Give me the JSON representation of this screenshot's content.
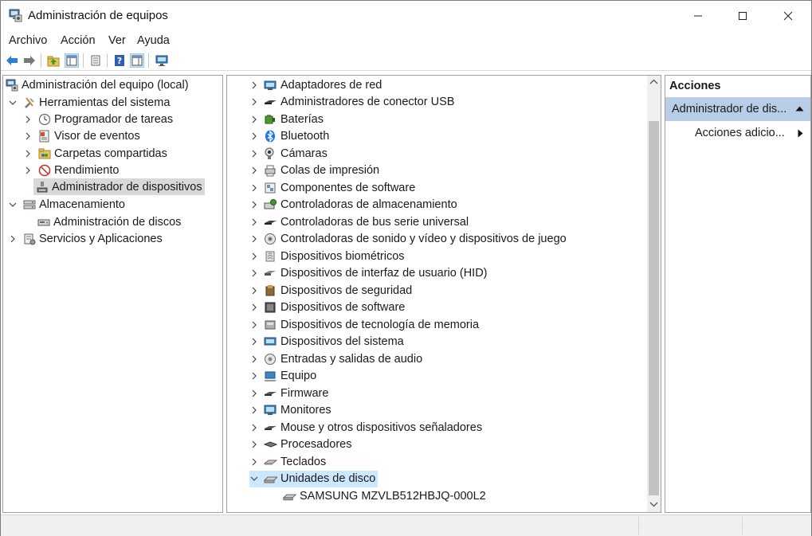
{
  "window": {
    "title": "Administración de equipos"
  },
  "menu": [
    "Archivo",
    "Acción",
    "Ver",
    "Ayuda"
  ],
  "toolbar": [
    "back-icon",
    "forward-icon",
    "up-folder-icon",
    "show-hide-tree-icon",
    "properties-icon",
    "help-icon",
    "show-hide-action-pane-icon",
    "monitor-icon"
  ],
  "left_tree": {
    "root": "Administración del equipo (local)",
    "system_tools": "Herramientas del sistema",
    "task_scheduler": "Programador de tareas",
    "event_viewer": "Visor de eventos",
    "shared_folders": "Carpetas compartidas",
    "performance": "Rendimiento",
    "device_manager": "Administrador de dispositivos",
    "storage": "Almacenamiento",
    "disk_management": "Administración de discos",
    "services_apps": "Servicios y Aplicaciones"
  },
  "devices": [
    "Adaptadores de red",
    "Administradores de conector USB",
    "Baterías",
    "Bluetooth",
    "Cámaras",
    "Colas de impresión",
    "Componentes de software",
    "Controladoras de almacenamiento",
    "Controladoras de bus serie universal",
    "Controladoras de sonido y vídeo y dispositivos de juego",
    "Dispositivos biométricos",
    "Dispositivos de interfaz de usuario (HID)",
    "Dispositivos de seguridad",
    "Dispositivos de software",
    "Dispositivos de tecnología de memoria",
    "Dispositivos del sistema",
    "Entradas y salidas de audio",
    "Equipo",
    "Firmware",
    "Monitores",
    "Mouse y otros dispositivos señaladores",
    "Procesadores",
    "Teclados",
    "Unidades de disco"
  ],
  "disk_child": "SAMSUNG MZVLB512HBJQ-000L2",
  "actions": {
    "header": "Acciones",
    "section": "Administrador de dis...",
    "more": "Acciones adicio..."
  }
}
